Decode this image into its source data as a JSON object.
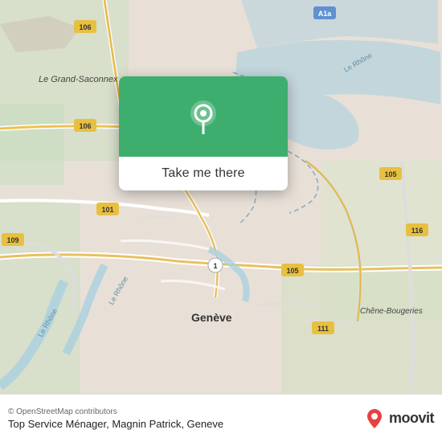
{
  "map": {
    "attribution": "© OpenStreetMap contributors",
    "place_name": "Top Service Ménager, Magnin Patrick, Geneve"
  },
  "popup": {
    "button_label": "Take me there"
  },
  "moovit": {
    "logo_text": "moovit"
  }
}
